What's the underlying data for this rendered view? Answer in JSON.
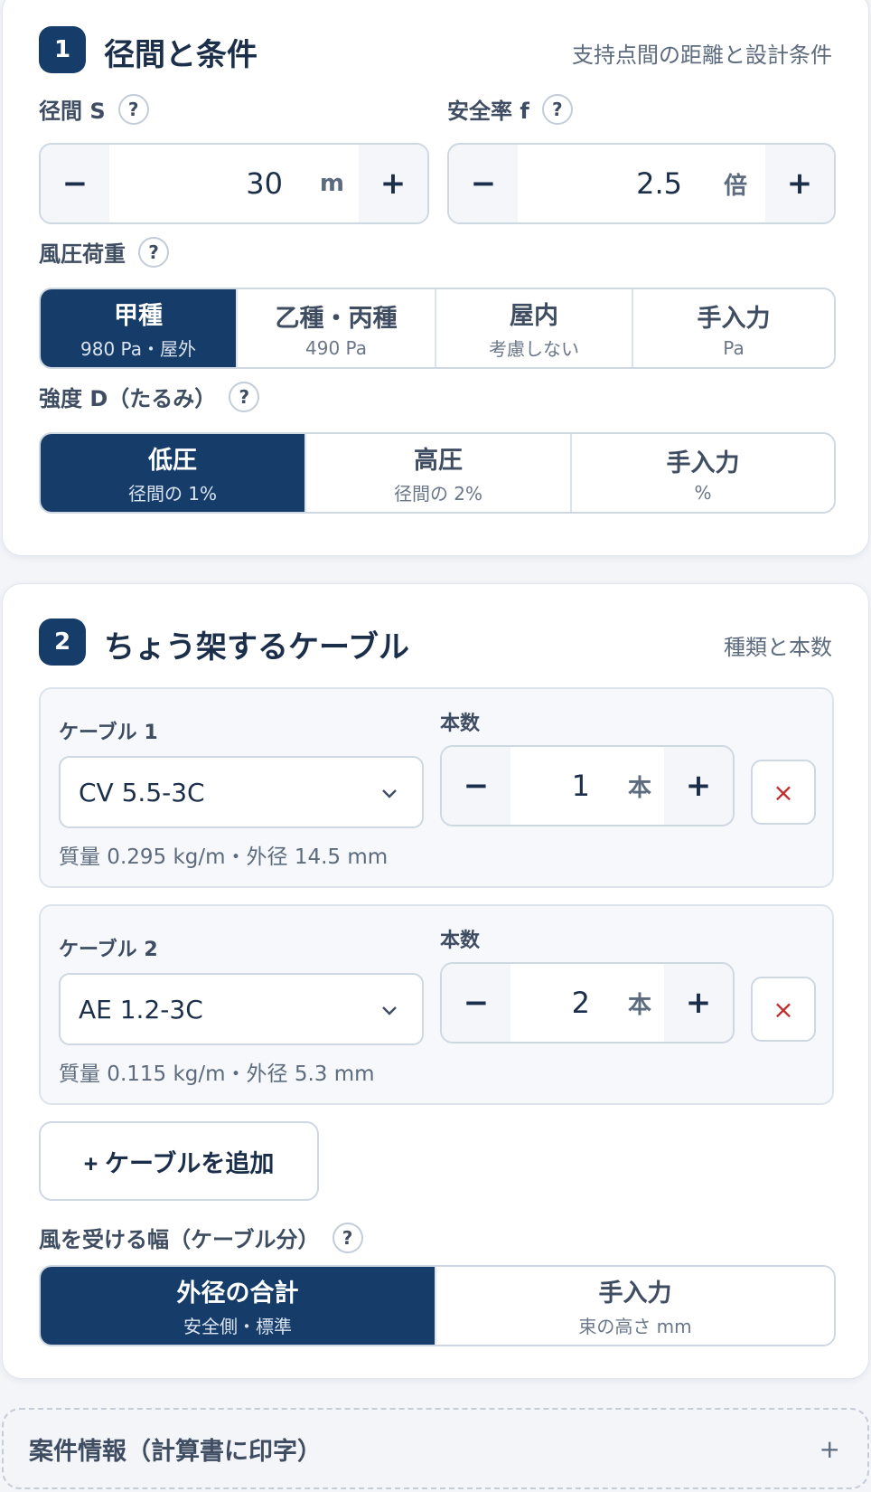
{
  "section1": {
    "number": "1",
    "title": "径間と条件",
    "subtitle": "支持点間の距離と設計条件",
    "span": {
      "label": "径間 S",
      "help": "?",
      "minus": "−",
      "plus": "+",
      "value": "30",
      "unit": "m"
    },
    "safety": {
      "label": "安全率 f",
      "help": "?",
      "minus": "−",
      "plus": "+",
      "value": "2.5",
      "unit": "倍"
    },
    "wind": {
      "label": "風圧荷重",
      "help": "?",
      "options": [
        {
          "main": "甲種",
          "note": "980 Pa・屋外",
          "active": true
        },
        {
          "main": "乙種・丙種",
          "note": "490 Pa",
          "active": false
        },
        {
          "main": "屋内",
          "note": "考慮しない",
          "active": false
        },
        {
          "main": "手入力",
          "note": "Pa",
          "active": false
        }
      ]
    },
    "strength": {
      "label": "強度 D（たるみ）",
      "help": "?",
      "options": [
        {
          "main": "低圧",
          "note": "径間の 1%",
          "active": true
        },
        {
          "main": "高圧",
          "note": "径間の 2%",
          "active": false
        },
        {
          "main": "手入力",
          "note": "%",
          "active": false
        }
      ]
    }
  },
  "section2": {
    "number": "2",
    "title": "ちょう架するケーブル",
    "subtitle": "種類と本数",
    "cables": [
      {
        "label": "ケーブル 1",
        "count_label": "本数",
        "type": "CV 5.5-3C",
        "count": "1",
        "unit": "本",
        "minus": "−",
        "plus": "+",
        "remove": "×",
        "meta": "質量 0.295 kg/m・外径 14.5 mm"
      },
      {
        "label": "ケーブル 2",
        "count_label": "本数",
        "type": "AE 1.2-3C",
        "count": "2",
        "unit": "本",
        "minus": "−",
        "plus": "+",
        "remove": "×",
        "meta": "質量 0.115 kg/m・外径 5.3 mm"
      }
    ],
    "add_label": "+ ケーブルを追加",
    "width": {
      "label": "風を受ける幅（ケーブル分）",
      "help": "?",
      "options": [
        {
          "main": "外径の合計",
          "note": "安全側・標準",
          "active": true
        },
        {
          "main": "手入力",
          "note": "束の高さ mm",
          "active": false
        }
      ]
    }
  },
  "project": {
    "title": "案件情報（計算書に印字）",
    "toggle": "+"
  },
  "colors": {
    "accent": "#163d69",
    "danger": "#c22b2b",
    "background": "#f3f5f9"
  }
}
